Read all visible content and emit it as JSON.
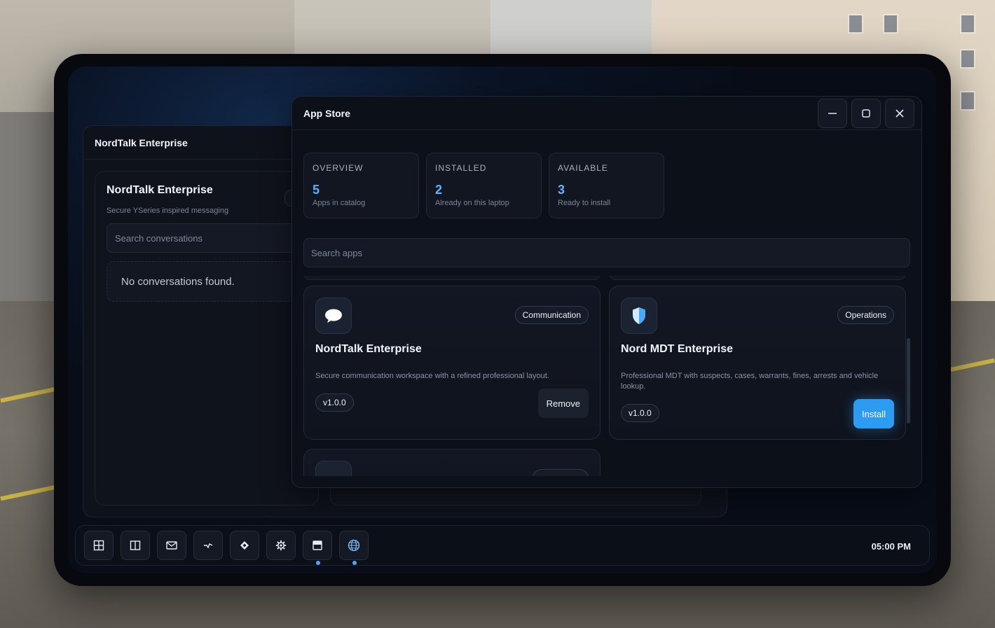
{
  "nordtalk": {
    "window_title": "NordTalk Enterprise",
    "heading": "NordTalk Enterprise",
    "subtitle": "Secure YSeries inspired messaging",
    "search_placeholder": "Search conversations",
    "empty_state": "No conversations found."
  },
  "appstore": {
    "title": "App Store",
    "controls": {
      "minimize": "minimize-icon",
      "maximize": "maximize-icon",
      "close": "close-icon"
    },
    "stats": [
      {
        "label": "OVERVIEW",
        "value": "5",
        "desc": "Apps in catalog"
      },
      {
        "label": "INSTALLED",
        "value": "2",
        "desc": "Already on this laptop"
      },
      {
        "label": "AVAILABLE",
        "value": "3",
        "desc": "Ready to install"
      }
    ],
    "search_placeholder": "Search apps",
    "apps": [
      {
        "icon": "chat-bubble-icon",
        "category": "Communication",
        "name": "NordTalk Enterprise",
        "description": "Secure communication workspace with a refined professional layout.",
        "version": "v1.0.0",
        "action": "Remove"
      },
      {
        "icon": "shield-icon",
        "category": "Operations",
        "name": "Nord MDT Enterprise",
        "description": "Professional MDT with suspects, cases, warrants, fines, arrests and vehicle lookup.",
        "version": "v1.0.0",
        "action": "Install"
      }
    ]
  },
  "taskbar": {
    "apps": [
      {
        "icon": "grid-icon"
      },
      {
        "icon": "columns-icon"
      },
      {
        "icon": "mail-icon"
      },
      {
        "icon": "pulse-icon"
      },
      {
        "icon": "diamond-icon"
      },
      {
        "icon": "gear-icon"
      },
      {
        "icon": "store-icon",
        "running": true
      },
      {
        "icon": "globe-icon",
        "running": true
      }
    ],
    "clock": "05:00 PM"
  },
  "colors": {
    "accent": "#5eb3ff",
    "install_button": "#2d9bf0",
    "window_bg": "#0c1019",
    "running_indicator": "#4da6ff"
  }
}
